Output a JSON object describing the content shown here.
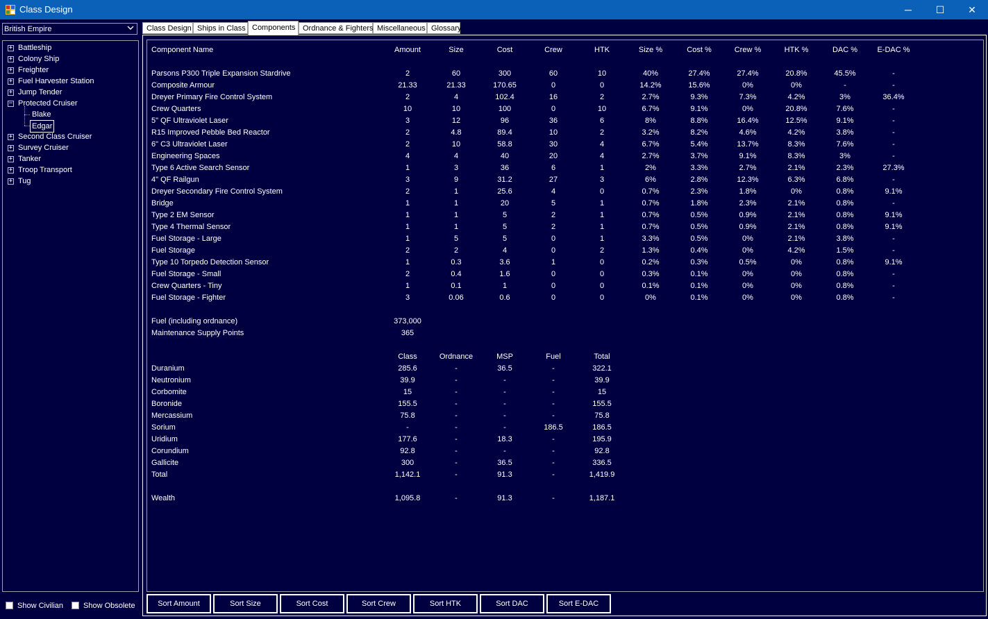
{
  "window": {
    "title": "Class Design",
    "buttons": {
      "minimize": "─",
      "maximize": "☐",
      "close": "✕"
    }
  },
  "empire_select": {
    "value": "British Empire"
  },
  "tree": {
    "items": [
      {
        "label": "Battleship",
        "expander": "+"
      },
      {
        "label": "Colony Ship",
        "expander": "+"
      },
      {
        "label": "Freighter",
        "expander": "+"
      },
      {
        "label": "Fuel Harvester Station",
        "expander": "+"
      },
      {
        "label": "Jump Tender",
        "expander": "+"
      },
      {
        "label": "Protected Cruiser",
        "expander": "−",
        "children": [
          "Blake",
          "Edgar"
        ]
      },
      {
        "label": "Second Class Cruiser",
        "expander": "+"
      },
      {
        "label": "Survey Cruiser",
        "expander": "+"
      },
      {
        "label": "Tanker",
        "expander": "+"
      },
      {
        "label": "Troop Transport",
        "expander": "+"
      },
      {
        "label": "Tug",
        "expander": "+"
      }
    ],
    "selected": "Edgar"
  },
  "checkboxes": {
    "show_civilian": "Show Civilian",
    "show_obsolete": "Show Obsolete"
  },
  "tabs": [
    "Class Design",
    "Ships in Class",
    "Components",
    "Ordnance & Fighters",
    "Miscellaneous",
    "Glossary"
  ],
  "active_tab": "Components",
  "components": {
    "headers": [
      "Component Name",
      "Amount",
      "Size",
      "Cost",
      "Crew",
      "HTK",
      "Size %",
      "Cost %",
      "Crew %",
      "HTK %",
      "DAC %",
      "E-DAC %"
    ],
    "rows": [
      [
        "Parsons P300 Triple Expansion Stardrive",
        "2",
        "60",
        "300",
        "60",
        "10",
        "40%",
        "27.4%",
        "27.4%",
        "20.8%",
        "45.5%",
        "-"
      ],
      [
        "Composite Armour",
        "21.33",
        "21.33",
        "170.65",
        "0",
        "0",
        "14.2%",
        "15.6%",
        "0%",
        "0%",
        "-",
        "-"
      ],
      [
        "Dreyer Primary Fire Control System",
        "2",
        "4",
        "102.4",
        "16",
        "2",
        "2.7%",
        "9.3%",
        "7.3%",
        "4.2%",
        "3%",
        "36.4%"
      ],
      [
        "Crew Quarters",
        "10",
        "10",
        "100",
        "0",
        "10",
        "6.7%",
        "9.1%",
        "0%",
        "20.8%",
        "7.6%",
        "-"
      ],
      [
        "5\" QF Ultraviolet Laser",
        "3",
        "12",
        "96",
        "36",
        "6",
        "8%",
        "8.8%",
        "16.4%",
        "12.5%",
        "9.1%",
        "-"
      ],
      [
        "R15 Improved Pebble Bed Reactor",
        "2",
        "4.8",
        "89.4",
        "10",
        "2",
        "3.2%",
        "8.2%",
        "4.6%",
        "4.2%",
        "3.8%",
        "-"
      ],
      [
        "6\" C3 Ultraviolet Laser",
        "2",
        "10",
        "58.8",
        "30",
        "4",
        "6.7%",
        "5.4%",
        "13.7%",
        "8.3%",
        "7.6%",
        "-"
      ],
      [
        "Engineering Spaces",
        "4",
        "4",
        "40",
        "20",
        "4",
        "2.7%",
        "3.7%",
        "9.1%",
        "8.3%",
        "3%",
        "-"
      ],
      [
        "Type 6 Active Search Sensor",
        "1",
        "3",
        "36",
        "6",
        "1",
        "2%",
        "3.3%",
        "2.7%",
        "2.1%",
        "2.3%",
        "27.3%"
      ],
      [
        "4\" QF Railgun",
        "3",
        "9",
        "31.2",
        "27",
        "3",
        "6%",
        "2.8%",
        "12.3%",
        "6.3%",
        "6.8%",
        "-"
      ],
      [
        "Dreyer Secondary Fire Control System",
        "2",
        "1",
        "25.6",
        "4",
        "0",
        "0.7%",
        "2.3%",
        "1.8%",
        "0%",
        "0.8%",
        "9.1%"
      ],
      [
        "Bridge",
        "1",
        "1",
        "20",
        "5",
        "1",
        "0.7%",
        "1.8%",
        "2.3%",
        "2.1%",
        "0.8%",
        "-"
      ],
      [
        "Type 2 EM Sensor",
        "1",
        "1",
        "5",
        "2",
        "1",
        "0.7%",
        "0.5%",
        "0.9%",
        "2.1%",
        "0.8%",
        "9.1%"
      ],
      [
        "Type 4 Thermal Sensor",
        "1",
        "1",
        "5",
        "2",
        "1",
        "0.7%",
        "0.5%",
        "0.9%",
        "2.1%",
        "0.8%",
        "9.1%"
      ],
      [
        "Fuel Storage - Large",
        "1",
        "5",
        "5",
        "0",
        "1",
        "3.3%",
        "0.5%",
        "0%",
        "2.1%",
        "3.8%",
        "-"
      ],
      [
        "Fuel Storage",
        "2",
        "2",
        "4",
        "0",
        "2",
        "1.3%",
        "0.4%",
        "0%",
        "4.2%",
        "1.5%",
        "-"
      ],
      [
        "Type 10 Torpedo Detection Sensor",
        "1",
        "0.3",
        "3.6",
        "1",
        "0",
        "0.2%",
        "0.3%",
        "0.5%",
        "0%",
        "0.8%",
        "9.1%"
      ],
      [
        "Fuel Storage - Small",
        "2",
        "0.4",
        "1.6",
        "0",
        "0",
        "0.3%",
        "0.1%",
        "0%",
        "0%",
        "0.8%",
        "-"
      ],
      [
        "Crew Quarters - Tiny",
        "1",
        "0.1",
        "1",
        "0",
        "0",
        "0.1%",
        "0.1%",
        "0%",
        "0%",
        "0.8%",
        "-"
      ],
      [
        "Fuel Storage - Fighter",
        "3",
        "0.06",
        "0.6",
        "0",
        "0",
        "0%",
        "0.1%",
        "0%",
        "0%",
        "0.8%",
        "-"
      ]
    ]
  },
  "summary": [
    {
      "label": "Fuel (including ordnance)",
      "value": "373,000"
    },
    {
      "label": "Maintenance Supply Points",
      "value": "365"
    }
  ],
  "minerals": {
    "headers": [
      "Class",
      "Ordnance",
      "MSP",
      "Fuel",
      "Total"
    ],
    "rows": [
      [
        "Duranium",
        "285.6",
        "-",
        "36.5",
        "-",
        "322.1"
      ],
      [
        "Neutronium",
        "39.9",
        "-",
        "-",
        "-",
        "39.9"
      ],
      [
        "Corbomite",
        "15",
        "-",
        "-",
        "-",
        "15"
      ],
      [
        "Boronide",
        "155.5",
        "-",
        "-",
        "-",
        "155.5"
      ],
      [
        "Mercassium",
        "75.8",
        "-",
        "-",
        "-",
        "75.8"
      ],
      [
        "Sorium",
        "-",
        "-",
        "-",
        "186.5",
        "186.5"
      ],
      [
        "Uridium",
        "177.6",
        "-",
        "18.3",
        "-",
        "195.9"
      ],
      [
        "Corundium",
        "92.8",
        "-",
        "-",
        "-",
        "92.8"
      ],
      [
        "Gallicite",
        "300",
        "-",
        "36.5",
        "-",
        "336.5"
      ],
      [
        "Total",
        "1,142.1",
        "-",
        "91.3",
        "-",
        "1,419.9"
      ]
    ],
    "wealth": [
      "Wealth",
      "1,095.8",
      "-",
      "91.3",
      "-",
      "1,187.1"
    ]
  },
  "sort_buttons": [
    "Sort Amount",
    "Sort Size",
    "Sort Cost",
    "Sort Crew",
    "Sort HTK",
    "Sort DAC",
    "Sort E-DAC"
  ],
  "colors": {
    "background": "#000040",
    "titlebar": "#0b61b8",
    "text": "#ffffff"
  }
}
